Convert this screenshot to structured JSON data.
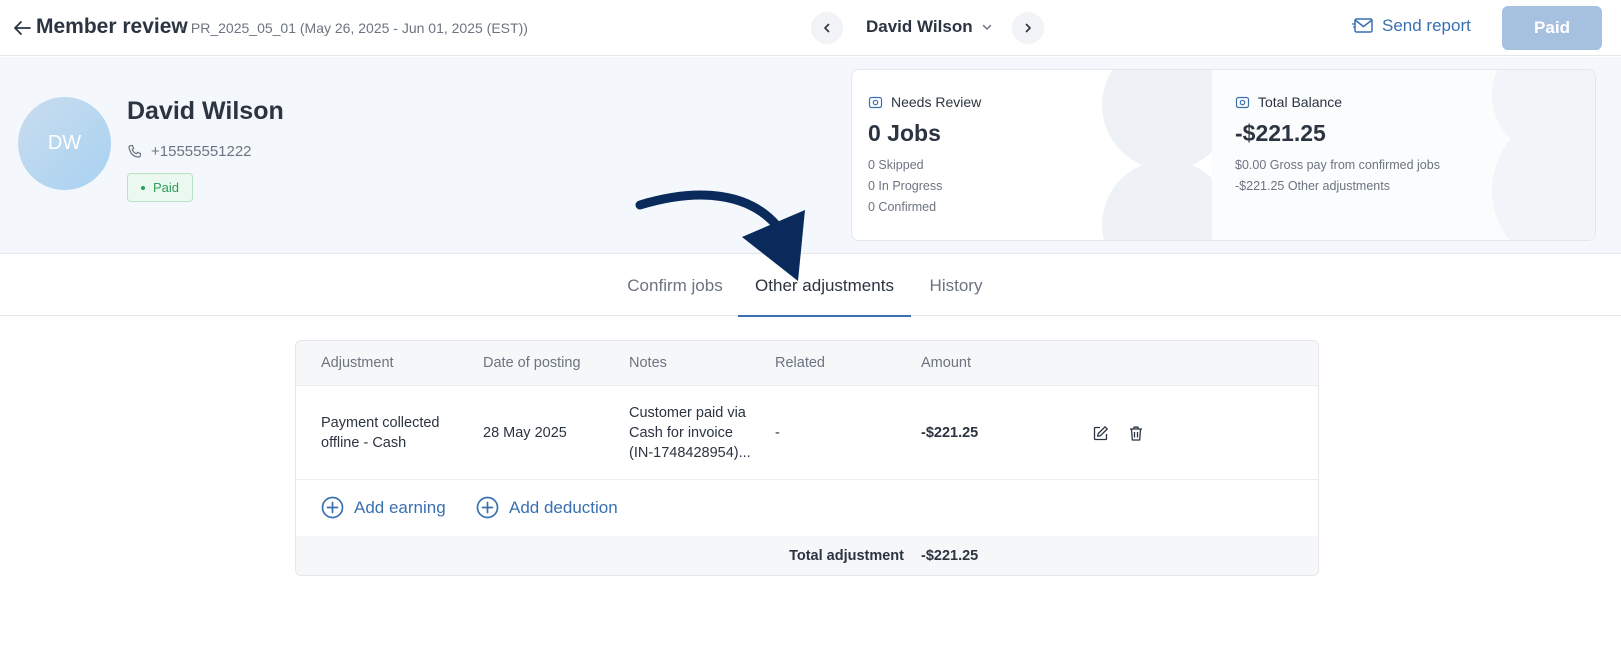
{
  "header": {
    "title": "Member review",
    "period": "PR_2025_05_01 (May 26, 2025 - Jun 01, 2025 (EST))",
    "member_select": "David Wilson",
    "send_report": "Send report",
    "paid_button": "Paid"
  },
  "member": {
    "initials": "DW",
    "name": "David Wilson",
    "phone": "+15555551222",
    "status": "Paid"
  },
  "summary": {
    "needs_review": {
      "label": "Needs Review",
      "value": "0 Jobs",
      "lines": [
        "0 Skipped",
        "0 In Progress",
        "0 Confirmed"
      ]
    },
    "total_balance": {
      "label": "Total Balance",
      "value": "-$221.25",
      "lines": [
        "$0.00 Gross pay from confirmed jobs",
        "-$221.25 Other adjustments"
      ]
    }
  },
  "tabs": [
    {
      "label": "Confirm jobs",
      "active": false
    },
    {
      "label": "Other adjustments",
      "active": true
    },
    {
      "label": "History",
      "active": false
    }
  ],
  "table": {
    "columns": [
      "Adjustment",
      "Date of posting",
      "Notes",
      "Related",
      "Amount"
    ],
    "rows": [
      {
        "adjustment_lines": [
          "Payment collected",
          "offline - Cash"
        ],
        "date": "28 May 2025",
        "notes_lines": [
          "Customer paid via",
          "Cash for invoice",
          "(IN-1748428954)..."
        ],
        "related": "-",
        "amount": "-$221.25"
      }
    ],
    "add_earning": "Add earning",
    "add_deduction": "Add deduction",
    "total_label": "Total adjustment",
    "total_value": "-$221.25"
  },
  "colors": {
    "accent": "#3a6fb0",
    "paid_button": "#a6c0e0",
    "status_green": "#2f9d5a",
    "arrow": "#0b2a5c"
  },
  "icons": {
    "back": "arrow-left-icon",
    "prev": "chevron-left-icon",
    "next": "chevron-right-icon",
    "dropdown": "chevron-down-icon",
    "send": "envelope-icon",
    "phone": "phone-icon",
    "summary": "gear-icon",
    "edit": "edit-icon",
    "delete": "trash-icon",
    "add": "plus-circle-icon"
  }
}
